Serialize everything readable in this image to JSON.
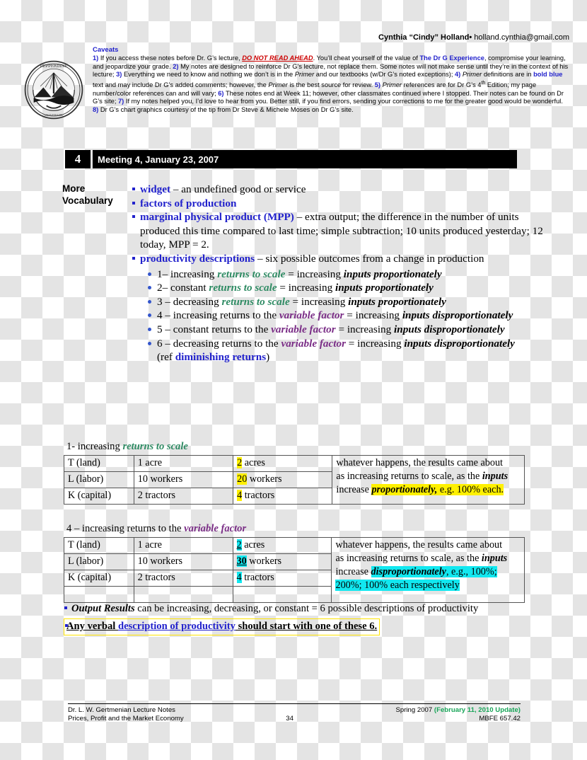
{
  "header": {
    "byline_name": "Cynthia “Cindy” Holland",
    "byline_sep": "•",
    "byline_email": "holland.cynthia@gmail.com",
    "caveats_title": "Caveats",
    "seal_text_top": "PEPPERDINE UNIVERSITY",
    "caveats": {
      "n1": "1)",
      "t1a": " If you access these notes before Dr. G’s lecture, ",
      "t1_red": "DO NOT READ AHEAD",
      "t1b": ".  You’ll cheat yourself of the value of ",
      "t1_blue": "The Dr G Experience",
      "t1c": ", compromise your learning, and jeopardize your grade. ",
      "n2": "2)",
      "t2": " My notes are designed to reinforce Dr G’s lecture, not replace them.  Some notes will not make sense until they’re in the context of his lecture; ",
      "n3": "3)",
      "t3a": " Everything we need to know and nothing we don’t is in the ",
      "t3_it1": "Primer",
      "t3b": " and our textbooks (w/Dr G’s noted exceptions); ",
      "n4": "4)",
      "t4a": " ",
      "t4_it": "Primer",
      "t4b": " definitions are in ",
      "t4_blue": "bold blue",
      "t4c": " text and may include Dr G’s added comments; however, the ",
      "t4_it2": "Primer",
      "t4d": " is the best source for review.  ",
      "n5": "5)",
      "t5a": " ",
      "t5_it": "Primer",
      "t5b": " references are for Dr G’s 4",
      "t5_sup": "th",
      "t5c": " Edition; my page number/color references can and will vary; ",
      "n6": "6)",
      "t6": " These notes end at Week 11; however, other classmates continued where I stopped.  Their notes can be found on Dr G’s site; ",
      "n7": "7)",
      "t7": " If my notes helped you, I’d love to hear from you.  Better still, if you find errors, sending your corrections to me for the greater good would be wonderful. ",
      "n8": "8)",
      "t8": " Dr G’s chart graphics courtesy of the tip from Dr Steve & Michele Moses on Dr G’s site."
    }
  },
  "meeting": {
    "number": "4",
    "title": "Meeting 4, January 23, 2007"
  },
  "vocabulary": {
    "label_line1": "More",
    "label_line2": "Vocabulary",
    "items": [
      {
        "term": "widget",
        "rest": " – an undefined good or service"
      },
      {
        "term": "factors of production",
        "rest": ""
      },
      {
        "term": "marginal physical product (MPP)",
        "rest": " – extra output; the difference in the number of units produced this time compared to last time; simple subtraction; 10 units produced yesterday; 12 today, MPP = 2."
      },
      {
        "term": "productivity descriptions",
        "rest": " – six possible outcomes from a change in production"
      }
    ],
    "descriptions": [
      {
        "num": "1–",
        "pre": " increasing ",
        "hi": "returns to scale",
        "hi_class": "rts",
        "post": " = increasing ",
        "tail": "inputs proportionately"
      },
      {
        "num": "2–",
        "pre": " constant ",
        "hi": "returns to scale",
        "hi_class": "rts",
        "post": " = increasing ",
        "tail": "inputs proportionately"
      },
      {
        "num": "3 –",
        "pre": " decreasing ",
        "hi": "returns to scale",
        "hi_class": "rts",
        "post": " = increasing ",
        "tail": "inputs proportionately"
      },
      {
        "num": "4 –",
        "pre": " increasing returns to the ",
        "hi": "variable factor",
        "hi_class": "vf",
        "post": " = increasing ",
        "tail": "inputs disproportionately"
      },
      {
        "num": "5 –",
        "pre": " constant returns to the ",
        "hi": "variable factor",
        "hi_class": "vf",
        "post": " = increasing ",
        "tail": "inputs disproportionately"
      },
      {
        "num": "6 –",
        "pre": " decreasing returns to the ",
        "hi": "variable factor",
        "hi_class": "vf",
        "post": " = increasing ",
        "tail": "inputs disproportionately"
      }
    ],
    "ref_pre": "(ref ",
    "ref_term": "diminishing returns",
    "ref_post": ")"
  },
  "table1": {
    "caption_pre": "1- increasing ",
    "caption_hi": "returns to scale",
    "rows": [
      {
        "c1": "T (land)",
        "c2": "1 acre",
        "c3_hl": "2",
        "c3_rest": " acres"
      },
      {
        "c1": "L (labor)",
        "c2": "10 workers",
        "c3_hl": "20",
        "c3_rest": " workers"
      },
      {
        "c1": "K (capital)",
        "c2": "2 tractors",
        "c3_hl": "4",
        "c3_rest": " tractors"
      }
    ],
    "note_line1": "whatever happens, the results came about",
    "note_line2a": "as increasing returns to scale, as the ",
    "note_line2b": "inputs",
    "note_line3a": "increase ",
    "note_line3b": "proportionately,",
    "note_line3c": " e.g. 100% each."
  },
  "table2": {
    "caption_pre": "4 – increasing returns to the ",
    "caption_hi": "variable factor",
    "rows": [
      {
        "c1": "T (land)",
        "c2": "1 acre",
        "c3_hl": "2",
        "c3_rest": " acres"
      },
      {
        "c1": "L (labor)",
        "c2": "10 workers",
        "c3_hl": "30",
        "c3_rest": " workers"
      },
      {
        "c1": "K (capital)",
        "c2": "2 tractors",
        "c3_hl": "4",
        "c3_rest": " tractors"
      }
    ],
    "note_line1": "whatever happens, the results came about",
    "note_line2a": "as increasing returns to scale, as the ",
    "note_line2b": "inputs",
    "note_line3a": "increase ",
    "note_line3b": "disproportionately",
    "note_line3c": ", e.g., 100%;",
    "note_line4": "200%; 100% each respectively"
  },
  "results": {
    "item1_bold": "Output Results",
    "item1_rest": " can be increasing, decreasing, or constant = 6 possible descriptions of productivity",
    "item2_a": "Any verbal ",
    "item2_blue": "description of productivity",
    "item2_b": " should start with one of these 6."
  },
  "footer": {
    "left_line1": "Dr. L. W. Gertmenian Lecture Notes",
    "left_line2": "Prices, Profit and the Market Economy",
    "page_number": "34",
    "right_line1_a": "Spring 2007 ",
    "right_line1_update": "(February 11, 2010 Update)",
    "right_line2": "MBFE 657.42"
  },
  "colors": {
    "blue": "#2222CC",
    "red": "#CC0000",
    "green_rts": "#2E8B63",
    "purple_vf": "#7A2D86",
    "highlight_yellow": "#FFF000",
    "highlight_cyan": "#12E8F0",
    "update_green": "#18A558"
  }
}
